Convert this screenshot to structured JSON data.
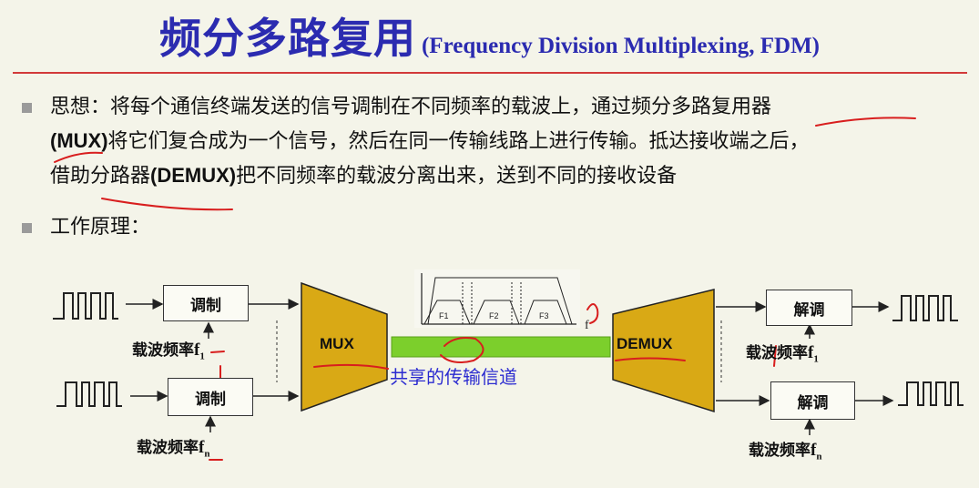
{
  "title": {
    "main": "频分多路复用",
    "sub": "(Frequency Division  Multiplexing, FDM)"
  },
  "bullets": {
    "idea": {
      "line1": "思想：将每个通信终端发送的信号调制在不同频率的载波上，通过频分多路复用器",
      "line2_bold": "(MUX)",
      "line2_rest": "将它们复合成为一个信号，然后在同一传输线路上进行传输。抵达接收端之后，",
      "line3_a": "借助分路器",
      "line3_bold": "(DEMUX)",
      "line3_rest": "把不同频率的载波分离出来，送到不同的接收设备"
    },
    "principle": "工作原理："
  },
  "diagram": {
    "modulate_label": "调制",
    "demodulate_label": "解调",
    "carrier_label": "载波频率",
    "carrier_symbol": "f",
    "carrier_sub_1": "1",
    "carrier_sub_n": "n",
    "mux_label": "MUX",
    "demux_label": "DEMUX",
    "channel_label": "共享的传输信道",
    "spectrum_bands": [
      "F1",
      "F2",
      "F3"
    ],
    "spectrum_axis": "f",
    "colors": {
      "title": "#2b2bb0",
      "mux_fill": "#d9a915",
      "channel": "#7ccf2c",
      "annotation": "#d81e1e",
      "channel_text": "#2b2bd0"
    }
  }
}
